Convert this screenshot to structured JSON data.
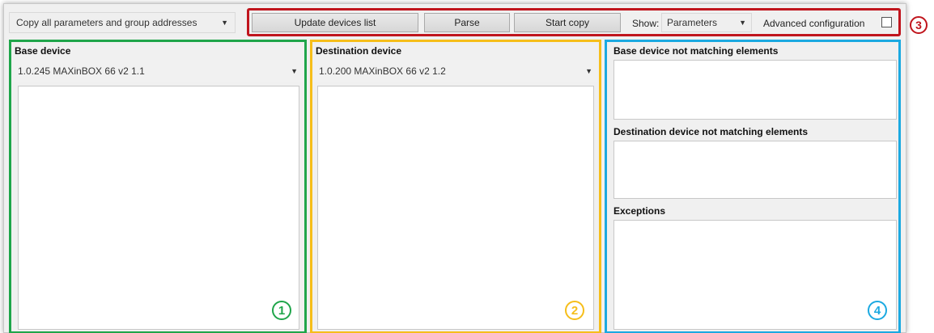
{
  "toolbar": {
    "copy_mode": "Copy all parameters and group addresses",
    "update_button": "Update devices list",
    "parse_button": "Parse",
    "start_copy_button": "Start copy",
    "show_label": "Show:",
    "show_value": "Parameters",
    "advanced_label": "Advanced configuration",
    "advanced_checked": false
  },
  "base": {
    "title": "Base device",
    "selected": "1.0.245  MAXinBOX 66 v2 1.1"
  },
  "destination": {
    "title": "Destination device",
    "selected": "1.0.200  MAXinBOX 66 v2 1.2"
  },
  "results": {
    "base_not_matching": "Base device not matching elements",
    "dest_not_matching": "Destination device not matching elements",
    "exceptions": "Exceptions"
  },
  "markers": {
    "one": "1",
    "two": "2",
    "three": "3",
    "four": "4"
  },
  "colors": {
    "red": "#c0151d",
    "green": "#1fa54a",
    "yellow": "#f6be1a",
    "blue": "#1ba9e1"
  }
}
